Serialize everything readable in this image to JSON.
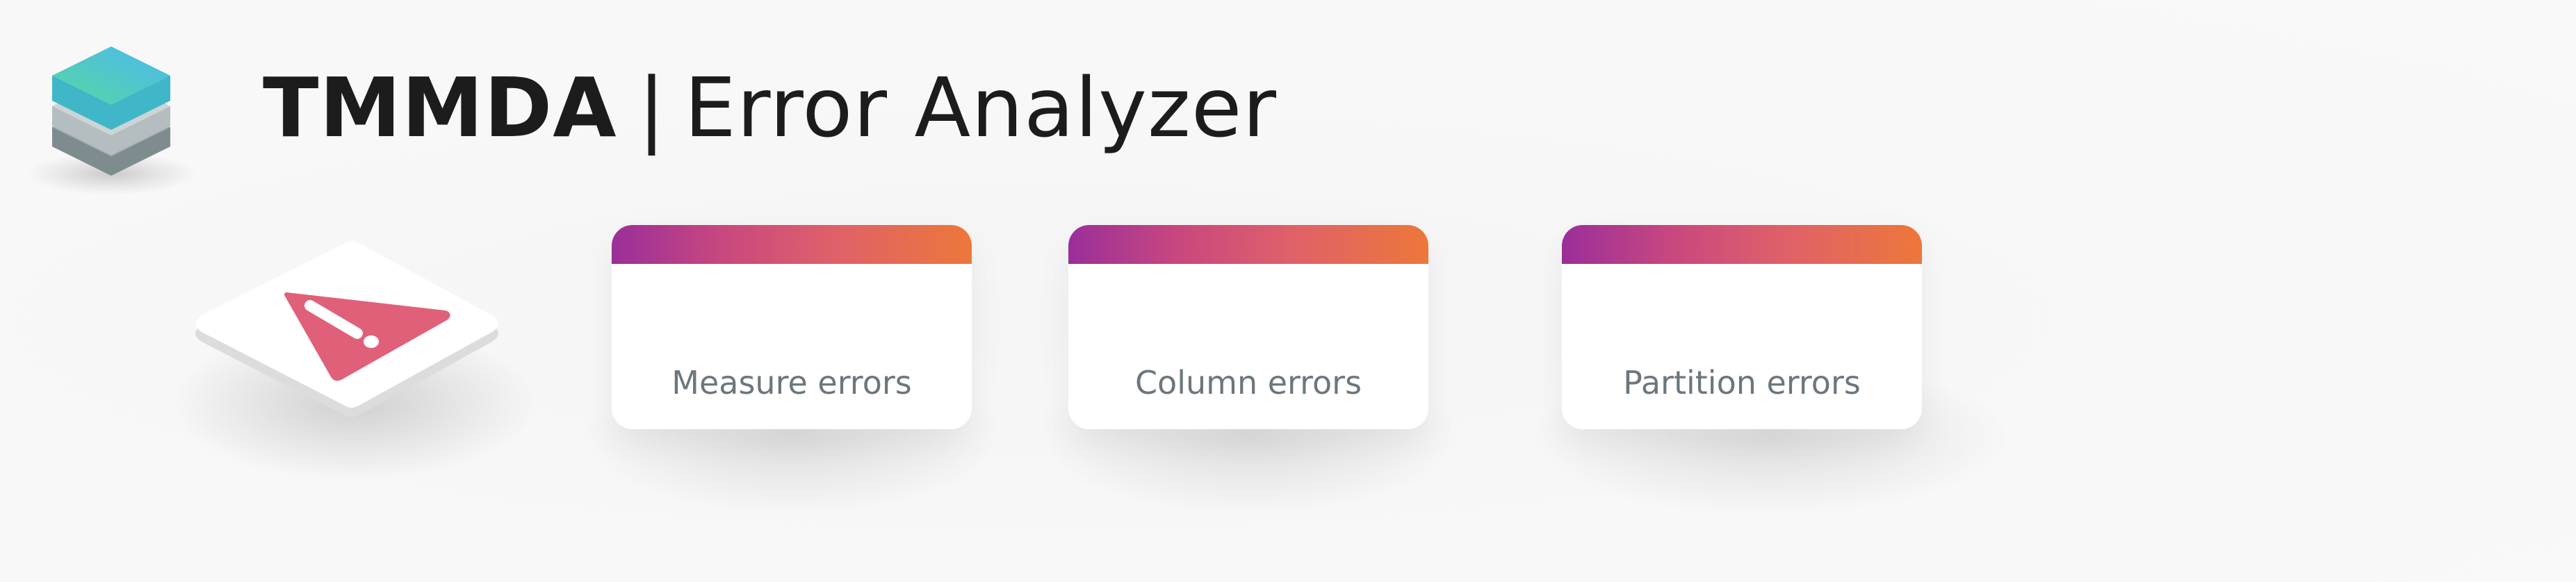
{
  "header": {
    "logo_icon": "layered-stack-icon",
    "brand": "TMMDA",
    "separator": "|",
    "subtitle": "Error Analyzer"
  },
  "warning": {
    "icon": "warning-triangle-icon",
    "color": "#e0607a"
  },
  "cards": [
    {
      "label": "Measure errors"
    },
    {
      "label": "Column errors"
    },
    {
      "label": "Partition errors"
    }
  ],
  "colors": {
    "accent_start": "#9a2e9a",
    "accent_end": "#ed773a",
    "card_text": "#6b777d",
    "title_text": "#1c1c1c"
  }
}
